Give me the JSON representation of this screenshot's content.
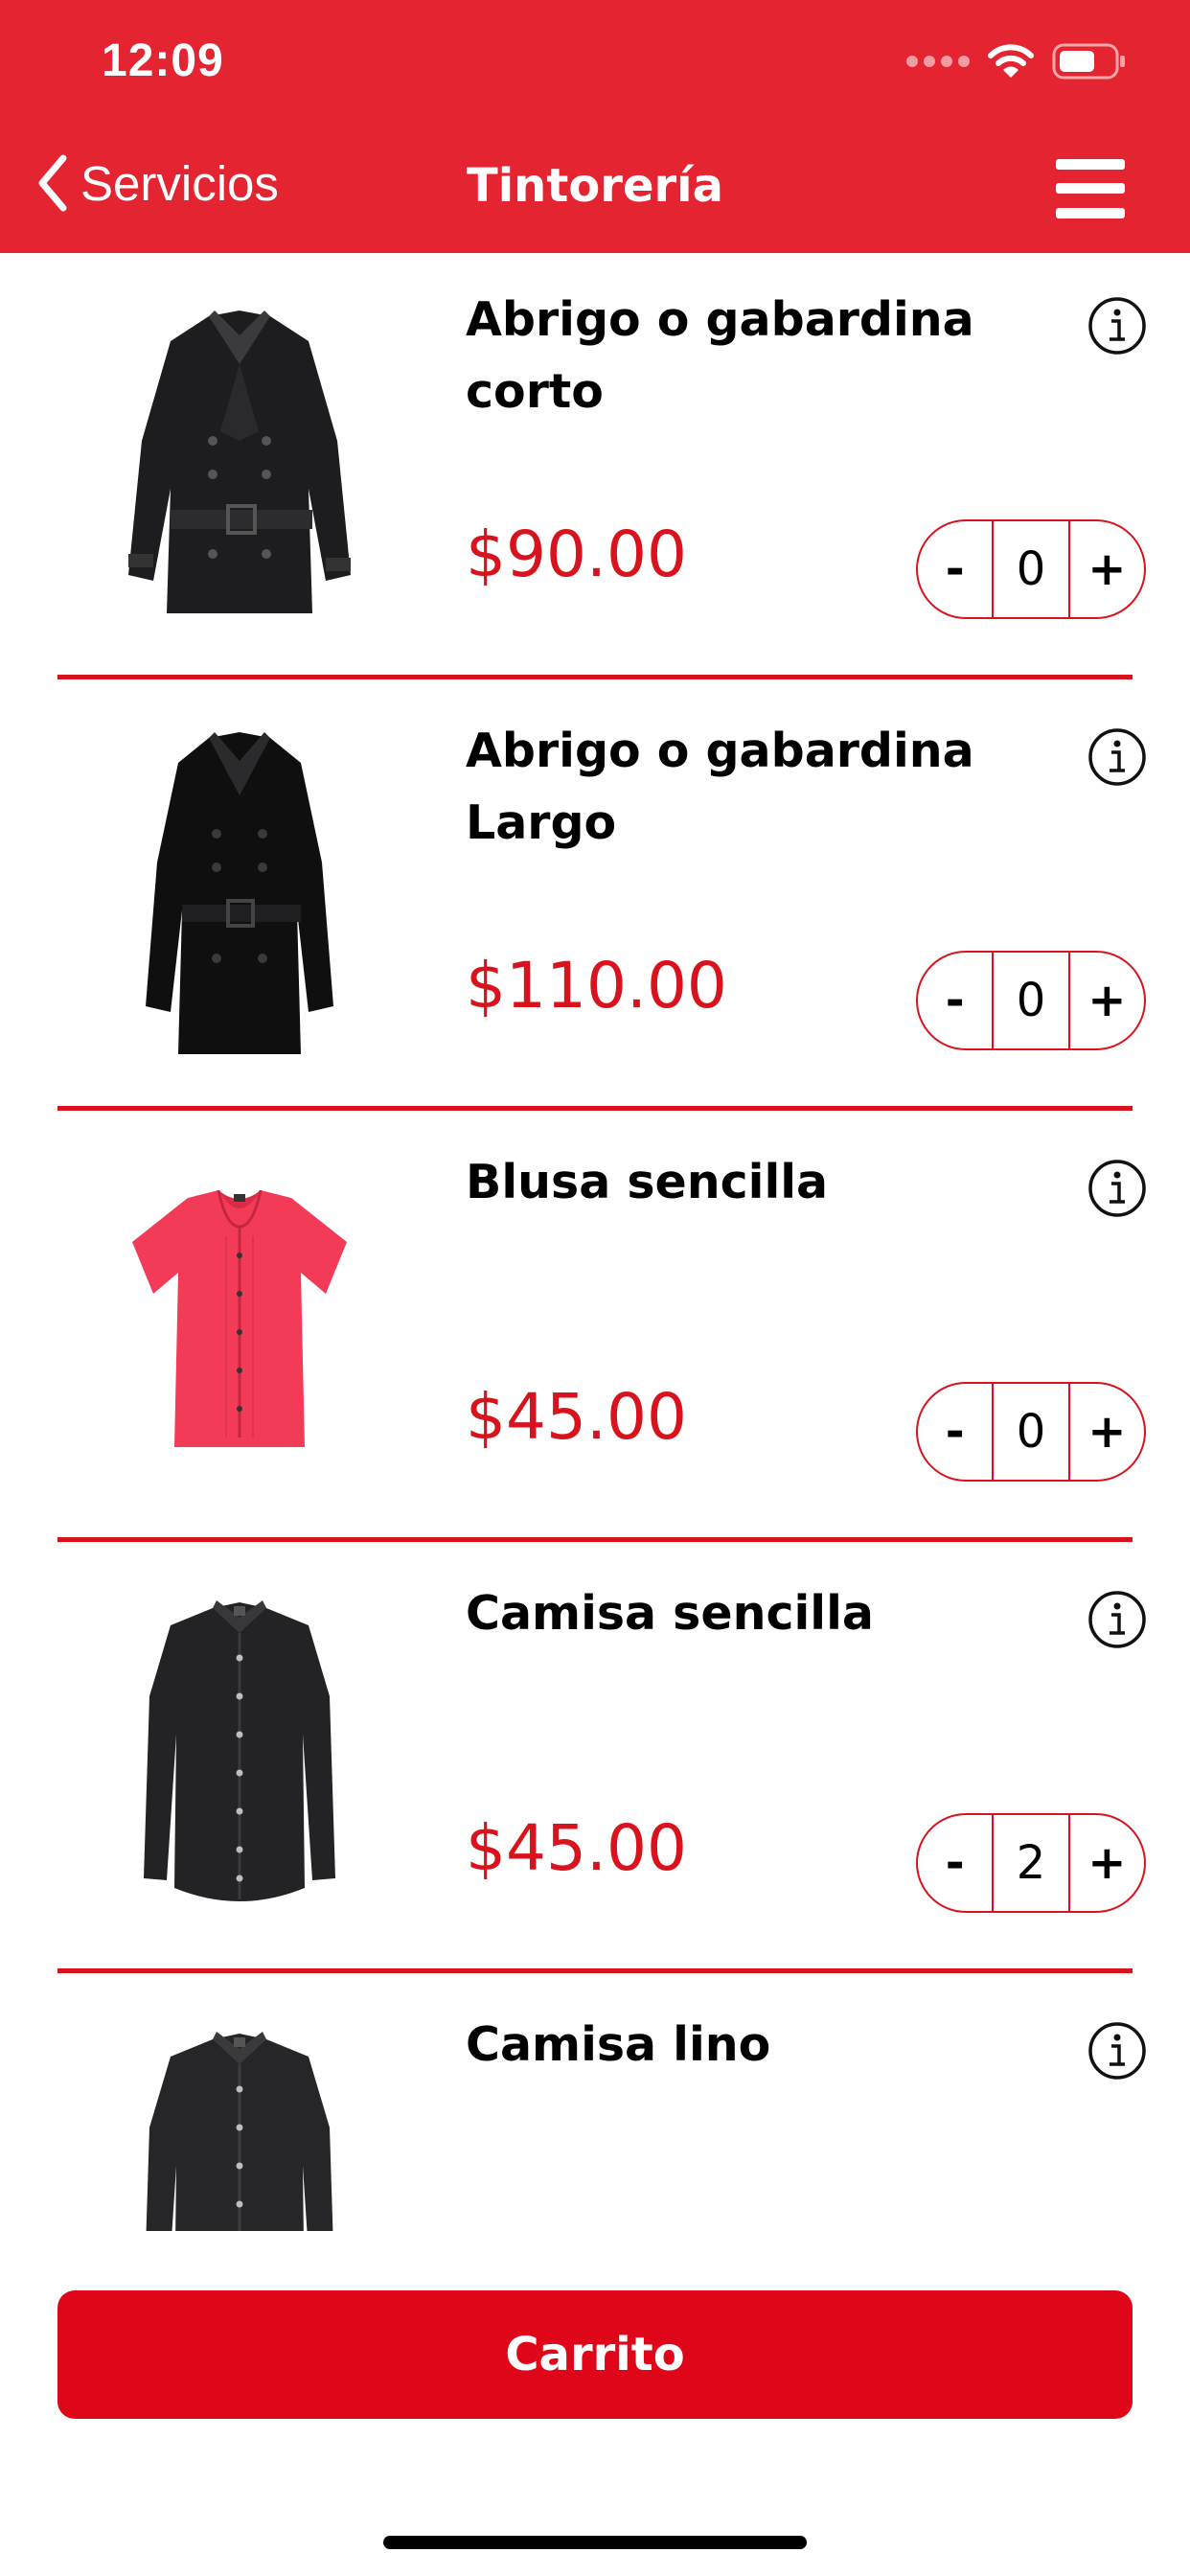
{
  "status_bar": {
    "time": "12:09",
    "icons": [
      "signal-icon",
      "wifi-icon",
      "battery-icon"
    ]
  },
  "nav": {
    "back_label": "Servicios",
    "title": "Tintorería",
    "menu_icon": "hamburger-menu-icon"
  },
  "items": [
    {
      "title": "Abrigo o gabardina corto",
      "price": "$90.00",
      "qty": "0",
      "minus": "-",
      "plus": "+"
    },
    {
      "title": "Abrigo o gabardina Largo",
      "price": "$110.00",
      "qty": "0",
      "minus": "-",
      "plus": "+"
    },
    {
      "title": "Blusa sencilla",
      "price": "$45.00",
      "qty": "0",
      "minus": "-",
      "plus": "+"
    },
    {
      "title": "Camisa sencilla",
      "price": "$45.00",
      "qty": "2",
      "minus": "-",
      "plus": "+"
    },
    {
      "title": "Camisa lino"
    }
  ],
  "cart": {
    "label": "Carrito"
  },
  "colors": {
    "header": "#e52431",
    "accent": "#d9131d",
    "button": "#e0061a"
  }
}
